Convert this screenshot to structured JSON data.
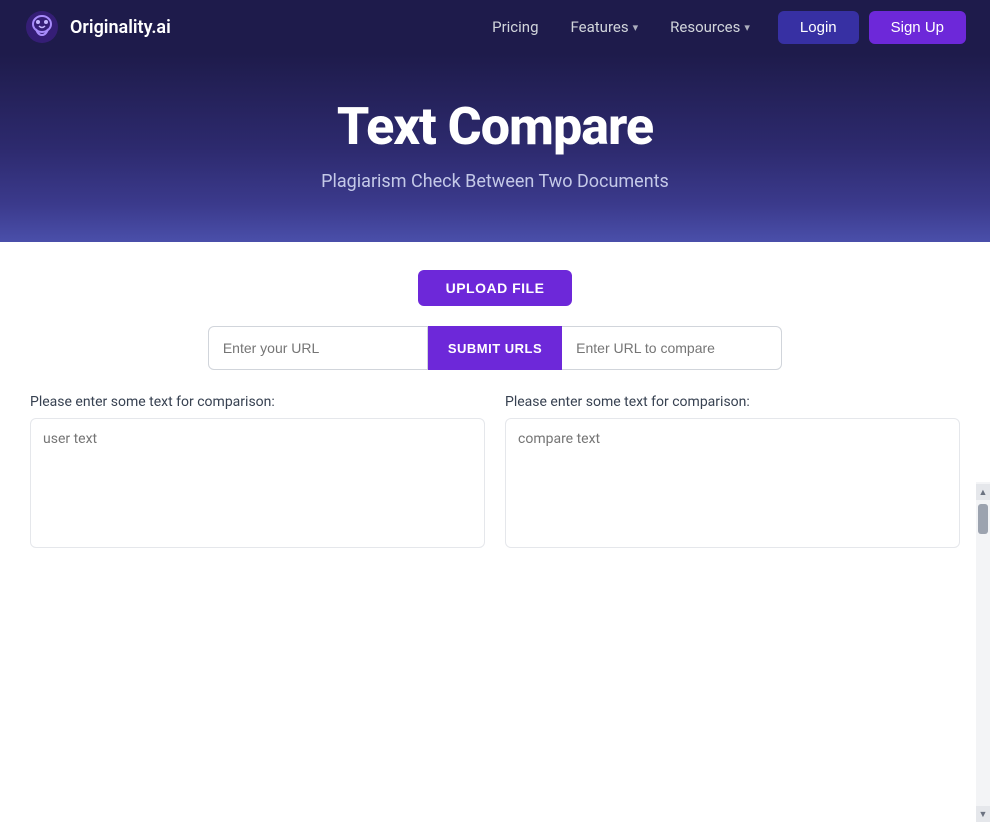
{
  "brand": {
    "logo_text": "Originality.ai",
    "logo_icon": "brain"
  },
  "navbar": {
    "links": [
      {
        "label": "Pricing",
        "has_dropdown": false
      },
      {
        "label": "Features",
        "has_dropdown": true
      },
      {
        "label": "Resources",
        "has_dropdown": true
      }
    ],
    "login_label": "Login",
    "signup_label": "Sign Up"
  },
  "hero": {
    "title": "Text Compare",
    "subtitle": "Plagiarism Check Between Two Documents"
  },
  "main": {
    "upload_button": "UPLOAD FILE",
    "url_placeholder_1": "Enter your URL",
    "url_placeholder_2": "Enter URL to compare",
    "submit_urls_label": "SUBMIT URLS",
    "text_label_1": "Please enter some text for comparison:",
    "text_label_2": "Please enter some text for comparison:",
    "text_placeholder_1": "user text",
    "text_placeholder_2": "compare text"
  }
}
